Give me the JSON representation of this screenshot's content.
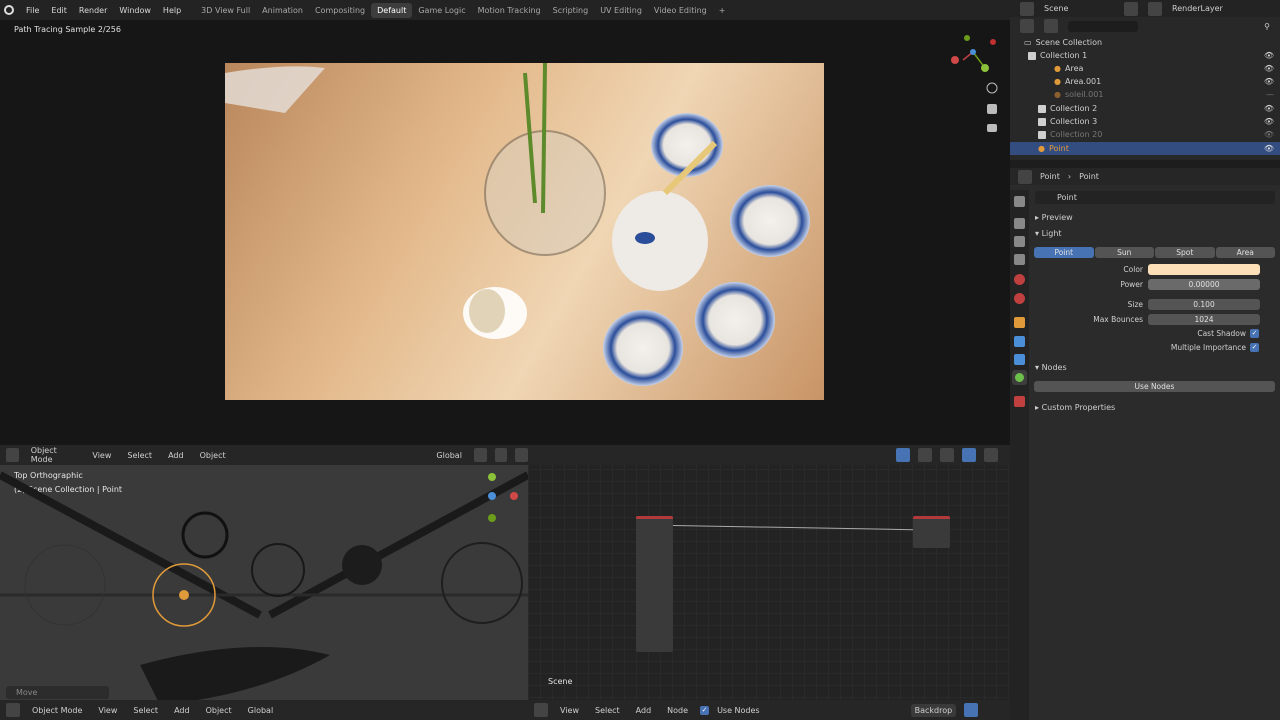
{
  "menu": {
    "items": [
      "File",
      "Edit",
      "Render",
      "Window",
      "Help"
    ]
  },
  "workspaces": {
    "tabs": [
      "3D View Full",
      "Animation",
      "Compositing",
      "Default",
      "Game Logic",
      "Motion Tracking",
      "Scripting",
      "UV Editing",
      "Video Editing"
    ],
    "active": "Default",
    "add": "+"
  },
  "render": {
    "status": "Path Tracing Sample 2/256"
  },
  "scene_bar": {
    "scene": "Scene",
    "render_layer": "RenderLayer"
  },
  "outliner": {
    "root": "Scene Collection",
    "rows": [
      {
        "label": "Collection 1",
        "depth": 1
      },
      {
        "label": "Area",
        "depth": 2
      },
      {
        "label": "Area.001",
        "depth": 2
      },
      {
        "label": "soleil.001",
        "depth": 2
      },
      {
        "label": "Collection 2",
        "depth": 1
      },
      {
        "label": "Collection 3",
        "depth": 1
      },
      {
        "label": "Collection 20",
        "depth": 1
      },
      {
        "label": "Point",
        "depth": 1
      }
    ]
  },
  "properties": {
    "breadcrumb_object": "Point",
    "breadcrumb_data": "Point",
    "datablock": "Point",
    "preview_label": "Preview",
    "light_label": "Light",
    "light_types": [
      "Point",
      "Sun",
      "Spot",
      "Area"
    ],
    "active_type": "Point",
    "color_label": "Color",
    "color_value": "#fde0b8",
    "power_label": "Power",
    "power_value": "0.00000",
    "size_label": "Size",
    "size_value": "0.100",
    "bounces_label": "Max Bounces",
    "bounces_value": "1024",
    "cast_shadow": "Cast Shadow",
    "multiple_importance": "Multiple Importance",
    "nodes_label": "Nodes",
    "use_nodes_btn": "Use Nodes",
    "custom_props": "Custom Properties"
  },
  "viewport": {
    "mode": "Object Mode",
    "menus": [
      "View",
      "Select",
      "Add",
      "Object"
    ],
    "orientation": "Global",
    "view_name": "Top Orthographic",
    "context": "(2) Scene Collection | Point",
    "last_op": "Move"
  },
  "node_editor": {
    "menus": [
      "View",
      "Select",
      "Add",
      "Node"
    ],
    "use_nodes": "Use Nodes",
    "scene_label": "Scene",
    "backdrop": "Backdrop"
  },
  "colors": {
    "accent": "#4772b3",
    "selected_row": "#334d80",
    "light_orange": "#e09a3a"
  }
}
